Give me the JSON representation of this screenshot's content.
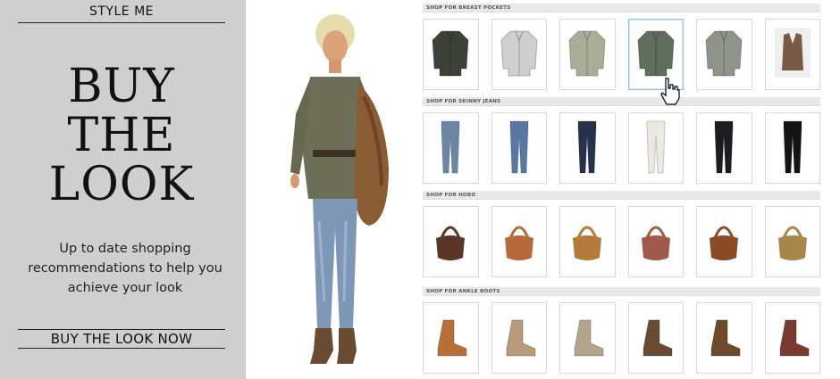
{
  "promo": {
    "brand": "STYLE ME",
    "headline": [
      "BUY",
      "THE",
      "LOOK"
    ],
    "description": "Up to date shopping recommendations to help you achieve your look",
    "cta": "BUY THE LOOK NOW"
  },
  "shop": {
    "sections": [
      {
        "label": "SHOP FOR BREAST POCKETS",
        "items": [
          {
            "icon": "jacket-icon",
            "color": "#3d4238"
          },
          {
            "icon": "shirt-icon",
            "color": "#cfcfcf"
          },
          {
            "icon": "shirt-icon",
            "color": "#a9ae98"
          },
          {
            "icon": "shirt-icon",
            "color": "#5f6e5d"
          },
          {
            "icon": "shirt-icon",
            "color": "#8e9488"
          },
          {
            "icon": "vest-icon",
            "color": "#7a5a45"
          }
        ]
      },
      {
        "label": "SHOP FOR SKINNY JEANS",
        "items": [
          {
            "icon": "jeans-icon",
            "color": "#6d86a8"
          },
          {
            "icon": "jeans-icon",
            "color": "#5877a1"
          },
          {
            "icon": "jeans-icon",
            "color": "#26314a"
          },
          {
            "icon": "jeans-icon",
            "color": "#ebe9e1"
          },
          {
            "icon": "jeans-icon",
            "color": "#1c1d20"
          },
          {
            "icon": "jeans-icon",
            "color": "#141414"
          }
        ]
      },
      {
        "label": "SHOP FOR HOBO",
        "items": [
          {
            "icon": "bag-icon",
            "color": "#5a3626"
          },
          {
            "icon": "bag-icon",
            "color": "#b46a3a"
          },
          {
            "icon": "bag-icon",
            "color": "#b57a3a"
          },
          {
            "icon": "bag-icon",
            "color": "#a05a4a"
          },
          {
            "icon": "bag-icon",
            "color": "#8a4a25"
          },
          {
            "icon": "bag-icon",
            "color": "#a6864a"
          }
        ]
      },
      {
        "label": "SHOP FOR ANKLE BOOTS",
        "items": [
          {
            "icon": "boot-icon",
            "color": "#b8703a"
          },
          {
            "icon": "boot-icon",
            "color": "#b99a7a"
          },
          {
            "icon": "boot-icon",
            "color": "#b3a48c"
          },
          {
            "icon": "boot-icon",
            "color": "#6a4a33"
          },
          {
            "icon": "boot-icon",
            "color": "#6d4a2a"
          },
          {
            "icon": "boot-icon",
            "color": "#7b3a30"
          }
        ]
      }
    ],
    "selected": {
      "section": 0,
      "item": 3
    }
  }
}
